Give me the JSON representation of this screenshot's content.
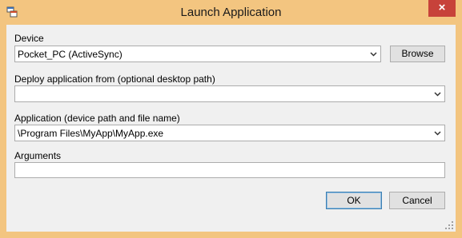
{
  "window": {
    "title": "Launch Application",
    "close_glyph": "×",
    "app_icon": "application-icon"
  },
  "device": {
    "label": "Device",
    "value": "Pocket_PC (ActiveSync)",
    "browse_label": "Browse"
  },
  "deploy": {
    "label": "Deploy application from (optional desktop path)",
    "value": ""
  },
  "application": {
    "label": "Application (device path and file name)",
    "value": "\\Program Files\\MyApp\\MyApp.exe"
  },
  "arguments": {
    "label": "Arguments",
    "value": ""
  },
  "buttons": {
    "ok": "OK",
    "cancel": "Cancel"
  },
  "colors": {
    "frame": "#f3c580",
    "close": "#c7423a",
    "client": "#f0f0f0"
  }
}
